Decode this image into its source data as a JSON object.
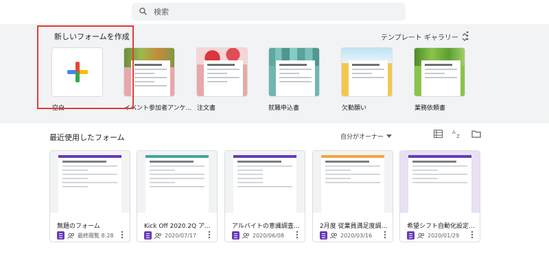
{
  "search": {
    "placeholder": "検索"
  },
  "templates": {
    "title": "新しいフォームを作成",
    "gallery_label": "テンプレート ギャラリー",
    "items": [
      {
        "label": "空白",
        "kind": "blank"
      },
      {
        "label": "イベント参加者アンケ...",
        "accent": "#e8a7ab"
      },
      {
        "label": "注文書",
        "accent": "#e9a8a8"
      },
      {
        "label": "就職申込書",
        "accent": "#6fb7b0"
      },
      {
        "label": "欠勤願い",
        "accent": "#f3c84f"
      },
      {
        "label": "業務依頼書",
        "accent": "#8bc34a"
      }
    ]
  },
  "recent": {
    "title": "最近使用したフォーム",
    "owner_filter": "自分がオーナー",
    "items": [
      {
        "title": "無題のフォーム",
        "meta": "最終閲覧 8:28",
        "color": "purple"
      },
      {
        "title": "Kick Off 2020.2Q アンケ...",
        "meta": "2020/07/17",
        "color": "teal"
      },
      {
        "title": "アルバイトの意識調査 - 新...",
        "meta": "2020/06/08",
        "color": "purple"
      },
      {
        "title": "2月度 従業員満足度調査 ※...",
        "meta": "2020/03/16",
        "color": "orange"
      },
      {
        "title": "希望シフト自動化設定フォ...",
        "meta": "2020/01/29",
        "color": "purple"
      }
    ]
  },
  "colors": {
    "highlight": "#e53935",
    "forms_purple": "#673ab7"
  }
}
